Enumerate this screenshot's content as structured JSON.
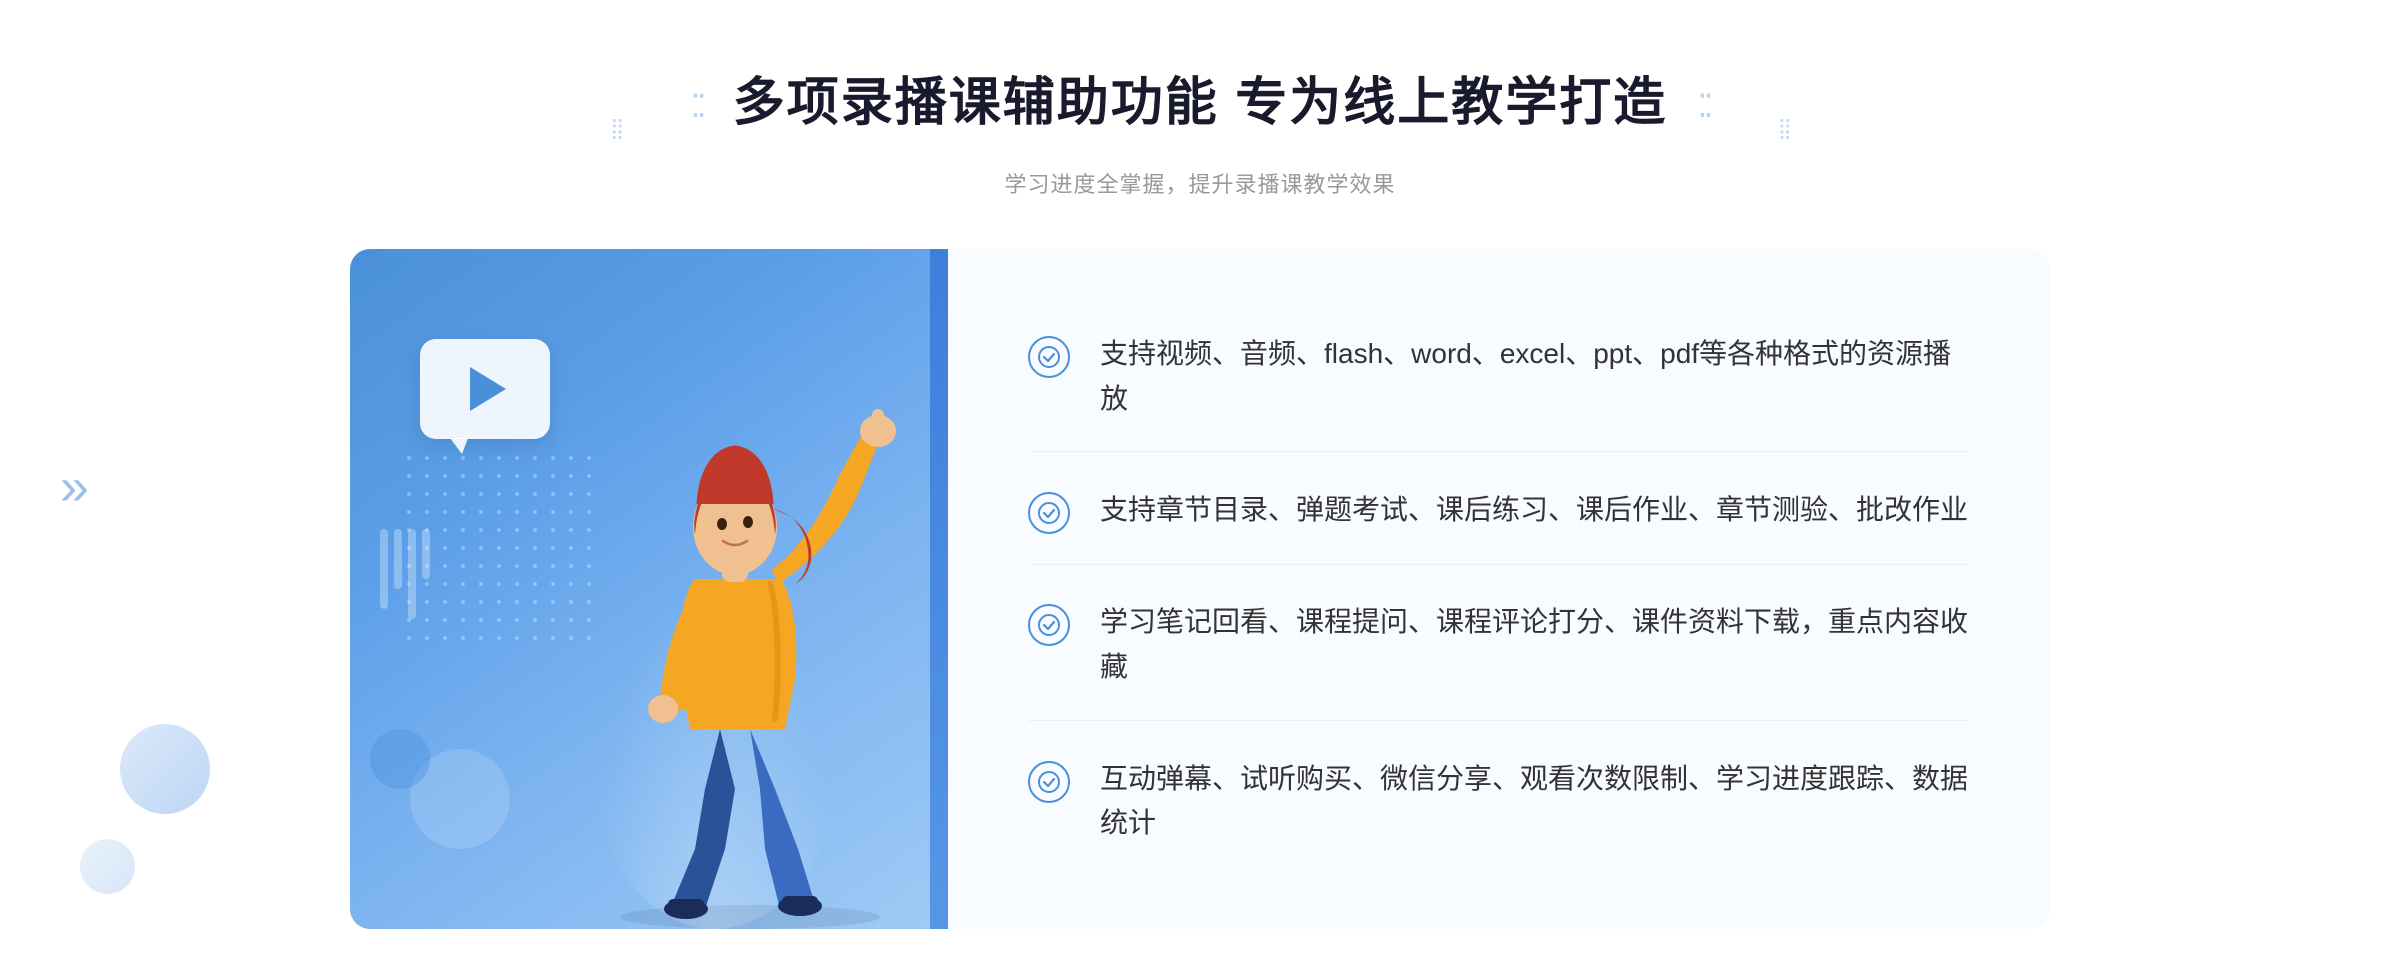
{
  "header": {
    "decorator_left": "⁚⁚",
    "decorator_right": "⁚⁚",
    "main_title": "多项录播课辅助功能 专为线上教学打造",
    "sub_title": "学习进度全掌握，提升录播课教学效果"
  },
  "features": [
    {
      "id": 1,
      "text": "支持视频、音频、flash、word、excel、ppt、pdf等各种格式的资源播放"
    },
    {
      "id": 2,
      "text": "支持章节目录、弹题考试、课后练习、课后作业、章节测验、批改作业"
    },
    {
      "id": 3,
      "text": "学习笔记回看、课程提问、课程评论打分、课件资料下载，重点内容收藏"
    },
    {
      "id": 4,
      "text": "互动弹幕、试听购买、微信分享、观看次数限制、学习进度跟踪、数据统计"
    }
  ],
  "icons": {
    "check": "✓",
    "play": "▶",
    "chevron": "»"
  },
  "colors": {
    "primary_blue": "#4a90d9",
    "light_blue_bg": "#f8fbff",
    "text_dark": "#1a1a2e",
    "text_gray": "#999999",
    "text_body": "#333333",
    "border": "#e8f0fb",
    "accent_bar": "#3d7fdb"
  }
}
